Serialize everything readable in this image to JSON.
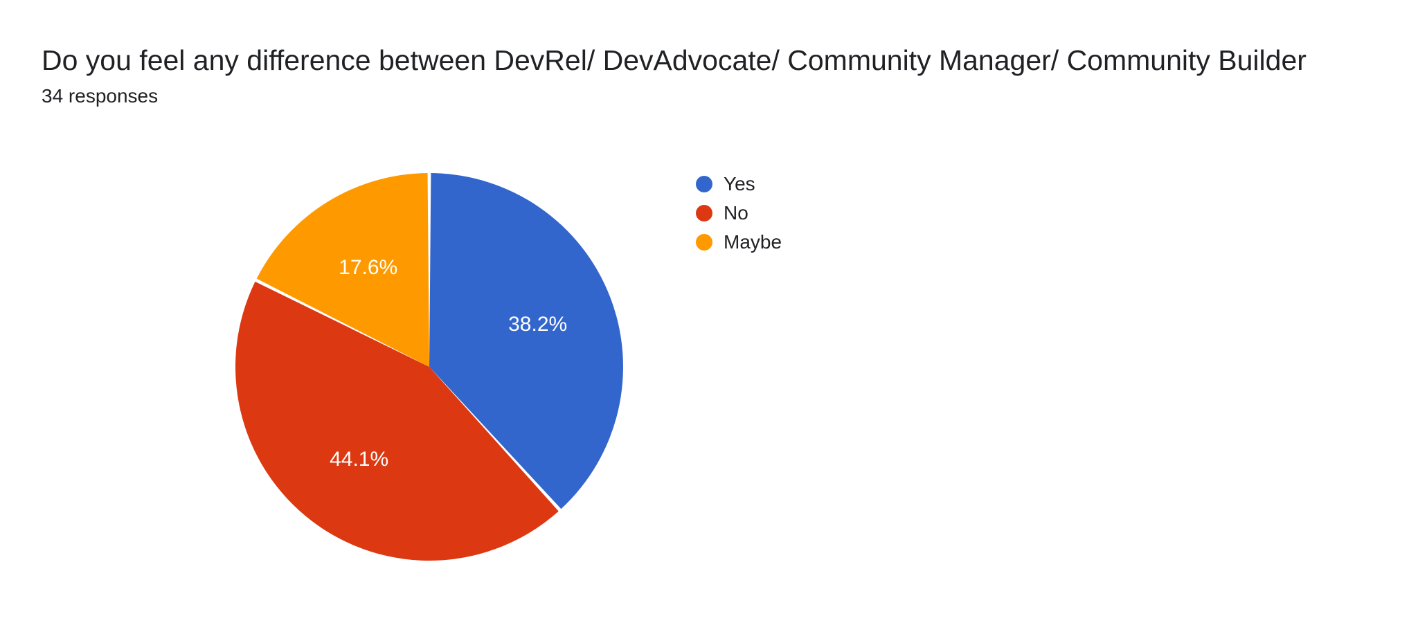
{
  "title": "Do you feel any difference between DevRel/ DevAdvocate/ Community Manager/ Community Builder",
  "subtitle": "34 responses",
  "chart_data": {
    "type": "pie",
    "title": "Do you feel any difference between DevRel/ DevAdvocate/ Community Manager/ Community Builder",
    "series": [
      {
        "name": "Yes",
        "value": 38.2,
        "label": "38.2%",
        "color": "#3366cc"
      },
      {
        "name": "No",
        "value": 44.1,
        "label": "44.1%",
        "color": "#dc3912"
      },
      {
        "name": "Maybe",
        "value": 17.6,
        "label": "17.6%",
        "color": "#ff9900"
      }
    ],
    "legend_position": "right",
    "responses": 34
  }
}
